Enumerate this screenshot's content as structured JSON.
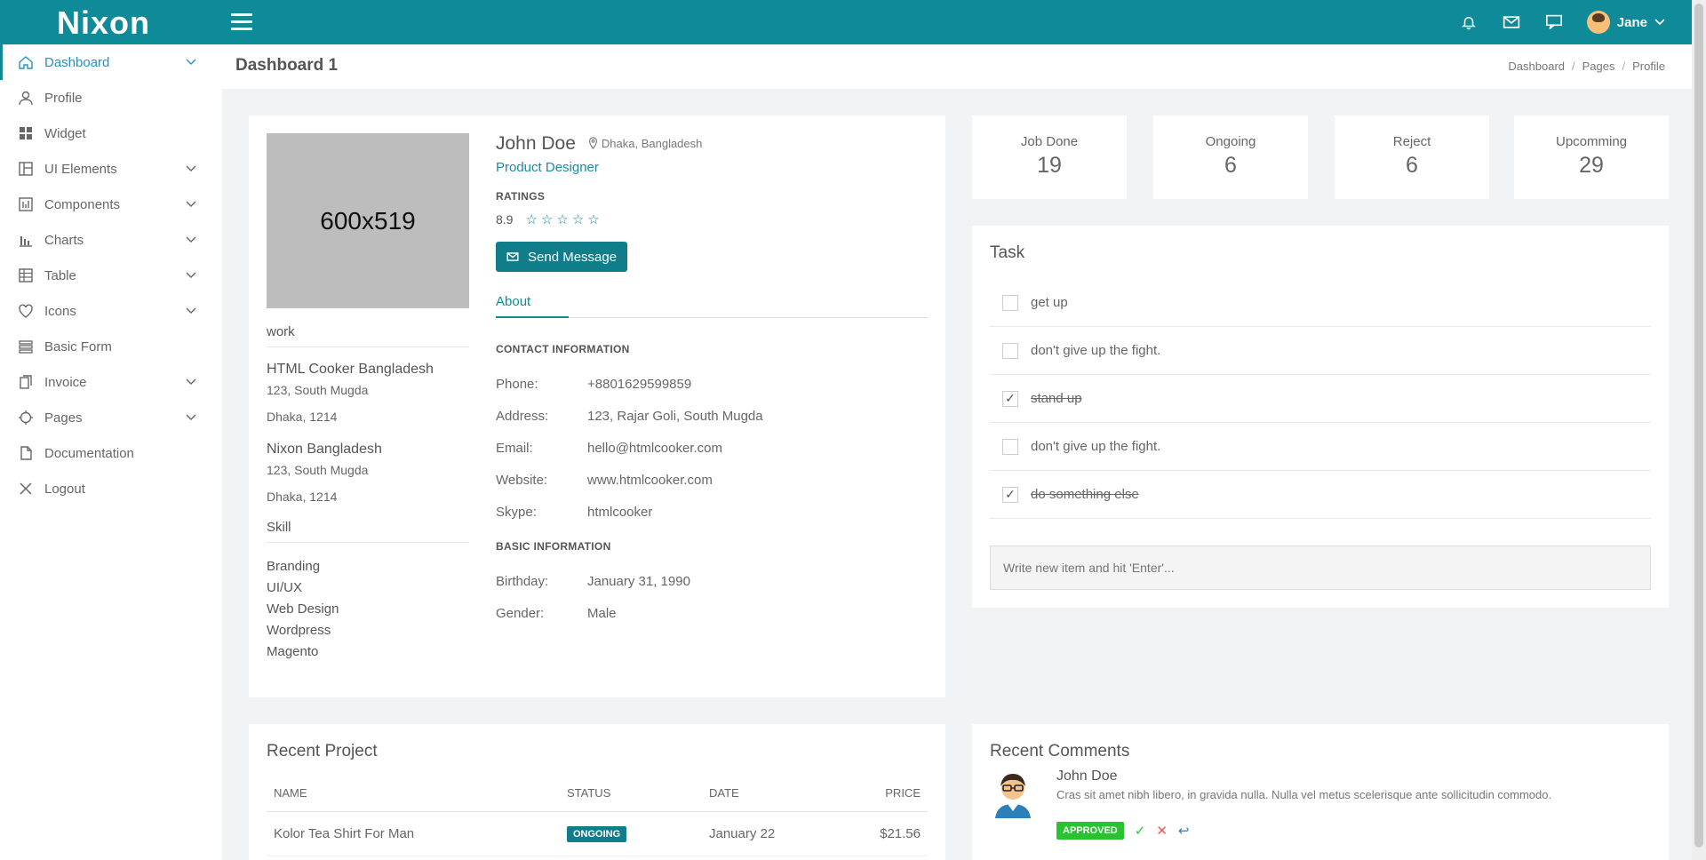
{
  "brand": {
    "logo": "Nixon"
  },
  "topbar": {
    "user_name": "Jane"
  },
  "sidebar": {
    "items": [
      {
        "label": "Dashboard",
        "icon": "home-icon",
        "has_chevron": true,
        "active": true
      },
      {
        "label": "Profile",
        "icon": "user-icon",
        "has_chevron": false
      },
      {
        "label": "Widget",
        "icon": "grid-icon",
        "has_chevron": false
      },
      {
        "label": "UI Elements",
        "icon": "layout-icon",
        "has_chevron": true
      },
      {
        "label": "Components",
        "icon": "components-icon",
        "has_chevron": true
      },
      {
        "label": "Charts",
        "icon": "bar-chart-icon",
        "has_chevron": true
      },
      {
        "label": "Table",
        "icon": "table-icon",
        "has_chevron": true
      },
      {
        "label": "Icons",
        "icon": "heart-icon",
        "has_chevron": true
      },
      {
        "label": "Basic Form",
        "icon": "form-icon",
        "has_chevron": false
      },
      {
        "label": "Invoice",
        "icon": "invoice-icon",
        "has_chevron": true
      },
      {
        "label": "Pages",
        "icon": "crosshair-icon",
        "has_chevron": true
      },
      {
        "label": "Documentation",
        "icon": "document-icon",
        "has_chevron": false
      },
      {
        "label": "Logout",
        "icon": "close-icon",
        "has_chevron": false
      }
    ]
  },
  "header": {
    "title": "Dashboard 1",
    "breadcrumb": [
      "Dashboard",
      "Pages",
      "Profile"
    ]
  },
  "profile": {
    "photo_placeholder": "600x519",
    "name": "John Doe",
    "location": "Dhaka, Bangladesh",
    "role": "Product Designer",
    "ratings_label": "RATINGS",
    "rating": "8.9",
    "stars_filled": 0,
    "stars_total": 5,
    "send_message": "Send Message",
    "tab_about": "About",
    "work_head": "work",
    "work": [
      {
        "name": "HTML Cooker Bangladesh",
        "line1": "123, South Mugda",
        "line2": "Dhaka, 1214"
      },
      {
        "name": "Nixon Bangladesh",
        "line1": "123, South Mugda",
        "line2": "Dhaka, 1214"
      }
    ],
    "skill_head": "Skill",
    "skills": [
      "Branding",
      "UI/UX",
      "Web Design",
      "Wordpress",
      "Magento"
    ],
    "contact_head": "CONTACT INFORMATION",
    "contact": [
      {
        "key": "Phone:",
        "value": "+8801629599859"
      },
      {
        "key": "Address:",
        "value": "123, Rajar Goli, South Mugda"
      },
      {
        "key": "Email:",
        "value": "hello@htmlcooker.com"
      },
      {
        "key": "Website:",
        "value": "www.htmlcooker.com"
      },
      {
        "key": "Skype:",
        "value": "htmlcooker"
      }
    ],
    "basic_head": "BASIC INFORMATION",
    "basic": [
      {
        "key": "Birthday:",
        "value": "January 31, 1990"
      },
      {
        "key": "Gender:",
        "value": "Male"
      }
    ]
  },
  "stats": [
    {
      "label": "Job Done",
      "value": "19"
    },
    {
      "label": "Ongoing",
      "value": "6"
    },
    {
      "label": "Reject",
      "value": "6"
    },
    {
      "label": "Upcomming",
      "value": "29"
    }
  ],
  "task": {
    "title": "Task",
    "items": [
      {
        "label": "get up",
        "done": false
      },
      {
        "label": "don't give up the fight.",
        "done": false
      },
      {
        "label": "stand up",
        "done": true
      },
      {
        "label": "don't give up the fight.",
        "done": false
      },
      {
        "label": "do something else",
        "done": true
      }
    ],
    "input_placeholder": "Write new item and hit 'Enter'..."
  },
  "recent_project": {
    "title": "Recent Project",
    "columns": [
      "NAME",
      "STATUS",
      "DATE",
      "PRICE"
    ],
    "rows": [
      {
        "name": "Kolor Tea Shirt For Man",
        "status": "ONGOING",
        "date": "January 22",
        "price": "$21.56"
      }
    ]
  },
  "recent_comments": {
    "title": "Recent Comments",
    "items": [
      {
        "name": "John Doe",
        "text": "Cras sit amet nibh libero, in gravida nulla. Nulla vel metus scelerisque ante sollicitudin commodo.",
        "status": "APPROVED"
      }
    ]
  },
  "colors": {
    "primary": "#0f8a99",
    "accent_link": "#1a8aa0",
    "approved": "#29c32f"
  }
}
